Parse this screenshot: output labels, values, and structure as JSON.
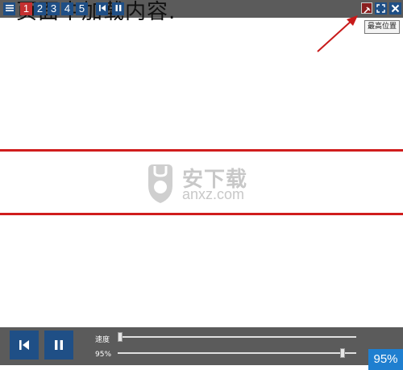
{
  "topbar": {
    "background_text": "页面中加载内容.",
    "page_buttons": [
      "1",
      "2",
      "3",
      "4",
      "5"
    ],
    "active_page": "1"
  },
  "tooltip": {
    "text": "最高位置"
  },
  "watermark": {
    "title": "安下载",
    "subtitle": "anxz.com"
  },
  "bottombar": {
    "speed_label": "速度",
    "zoom_label": "95%",
    "zoom_value": "95%",
    "speed_level": 0.0,
    "zoom_level": 0.95
  },
  "colors": {
    "bar": "#5b5b5b",
    "button_blue": "#1f4f86",
    "active_red": "#c43030",
    "accent_line": "#d01d1d",
    "zoom_box": "#1f7fd0"
  }
}
